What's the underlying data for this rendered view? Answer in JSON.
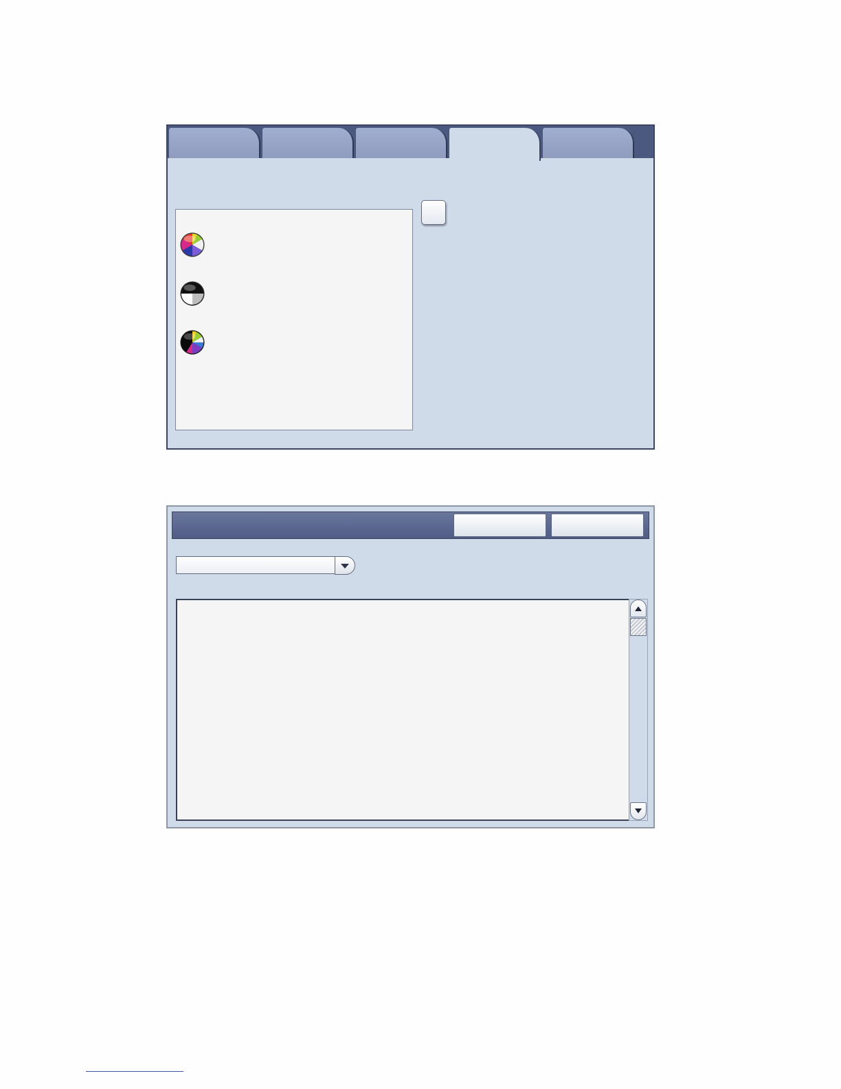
{
  "tabs": [
    {
      "label": "",
      "active": false
    },
    {
      "label": "",
      "active": false
    },
    {
      "label": "",
      "active": false
    },
    {
      "label": "",
      "active": true
    },
    {
      "label": "",
      "active": false
    }
  ],
  "color_options": [
    {
      "icon": "full-color-wheel-icon",
      "label": ""
    },
    {
      "icon": "black-and-white-icon",
      "label": ""
    },
    {
      "icon": "dual-color-icon",
      "label": ""
    }
  ],
  "checkbox": {
    "label": "",
    "checked": false
  },
  "dialog": {
    "title": "",
    "cancel_label": "",
    "save_label": "",
    "select_value": ""
  },
  "colors": {
    "panel_bg": "#d0dbea",
    "tab_inactive": "#9aa6c8",
    "header_bar": "#5a6690",
    "list_bg": "#f5f5f5"
  }
}
